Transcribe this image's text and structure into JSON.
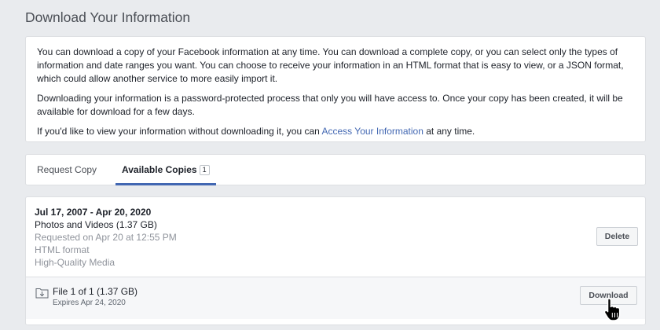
{
  "page": {
    "title": "Download Your Information"
  },
  "intro": {
    "paragraph1": "You can download a copy of your Facebook information at any time. You can download a complete copy, or you can select only the types of information and date ranges you want. You can choose to receive your information in an HTML format that is easy to view, or a JSON format, which could allow another service to more easily import it.",
    "paragraph2": "Downloading your information is a password-protected process that only you will have access to. Once your copy has been created, it will be available for download for a few days.",
    "paragraph3_before": "If you'd like to view your information without downloading it, you can ",
    "paragraph3_link": "Access Your Information",
    "paragraph3_after": " at any time."
  },
  "tabs": [
    {
      "label": "Request Copy",
      "active": false
    },
    {
      "label": "Available Copies",
      "active": true,
      "badge": "1"
    }
  ],
  "copy": {
    "date_range": "Jul 17, 2007 - Apr 20, 2020",
    "type": "Photos and Videos (1.37 GB)",
    "requested": "Requested on Apr 20 at 12:55 PM",
    "format": "HTML format",
    "quality": "High-Quality Media",
    "delete_label": "Delete",
    "file": {
      "label": "File 1 of 1 (1.37 GB)",
      "expiry": "Expires Apr 24, 2020",
      "download_label": "Download",
      "icon": "download-file-icon"
    }
  },
  "colors": {
    "background": "#e9ebee",
    "link": "#4267b2",
    "tab_underline": "#4267b2",
    "muted_text": "#90949c"
  }
}
